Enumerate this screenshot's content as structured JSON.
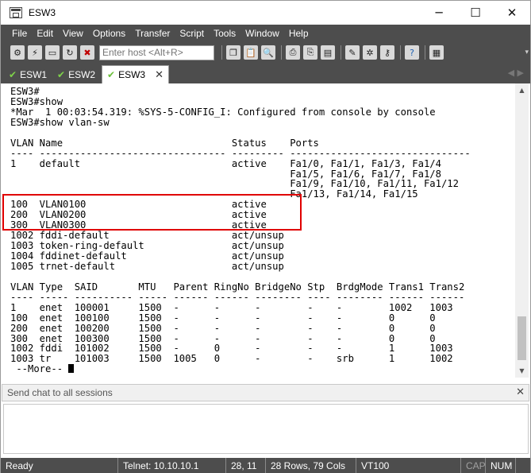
{
  "window": {
    "title": "ESW3",
    "controls": {
      "minimize": "─",
      "maximize": "☐",
      "close": "✕"
    }
  },
  "menu": [
    "File",
    "Edit",
    "View",
    "Options",
    "Transfer",
    "Script",
    "Tools",
    "Window",
    "Help"
  ],
  "toolbar": {
    "host_placeholder": "Enter host <Alt+R>",
    "icons": [
      "connect-icon",
      "quick-connect-icon",
      "connect-tab-icon",
      "reconnect-icon",
      "disconnect-icon",
      "copy-icon",
      "paste-icon",
      "find-icon",
      "print-icon",
      "print-selection-icon",
      "print-screen-icon",
      "session-options-icon",
      "global-options-icon",
      "keymap-icon",
      "help-icon",
      "map-icon"
    ]
  },
  "tabs": [
    {
      "label": "ESW1",
      "active": false
    },
    {
      "label": "ESW2",
      "active": false
    },
    {
      "label": "ESW3",
      "active": true
    }
  ],
  "terminal": {
    "lines": [
      "ESW3#",
      "ESW3#show",
      "*Mar  1 00:03:54.319: %SYS-5-CONFIG_I: Configured from console by console",
      "ESW3#show vlan-sw",
      "",
      "VLAN Name                             Status    Ports",
      "---- -------------------------------- --------- -------------------------------",
      "1    default                          active    Fa1/0, Fa1/1, Fa1/3, Fa1/4",
      "                                                Fa1/5, Fa1/6, Fa1/7, Fa1/8",
      "                                                Fa1/9, Fa1/10, Fa1/11, Fa1/12",
      "                                                Fa1/13, Fa1/14, Fa1/15",
      "100  VLAN0100                         active",
      "200  VLAN0200                         active",
      "300  VLAN0300                         active",
      "1002 fddi-default                     act/unsup",
      "1003 token-ring-default               act/unsup",
      "1004 fddinet-default                  act/unsup",
      "1005 trnet-default                    act/unsup",
      "",
      "VLAN Type  SAID       MTU   Parent RingNo BridgeNo Stp  BrdgMode Trans1 Trans2",
      "---- ----- ---------- ----- ------ ------ -------- ---- -------- ------ ------",
      "1    enet  100001     1500  -      -      -        -    -        1002   1003",
      "100  enet  100100     1500  -      -      -        -    -        0      0",
      "200  enet  100200     1500  -      -      -        -    -        0      0",
      "300  enet  100300     1500  -      -      -        -    -        0      0",
      "1002 fddi  101002     1500  -      0      -        -    -        1      1003",
      "1003 tr    101003     1500  1005   0      -        -    srb      1      1002"
    ],
    "more_prompt": " --More-- "
  },
  "chat": {
    "header": "Send chat to all sessions",
    "close": "✕"
  },
  "status": {
    "ready": "Ready",
    "connection": "Telnet: 10.10.10.1",
    "cursor_pos": "28,  11",
    "size": "28 Rows, 79 Cols",
    "terminal_type": "VT100",
    "caps": "CAP",
    "num": "NUM"
  },
  "colors": {
    "chrome": "#4d4d4d",
    "highlight": "#e00000",
    "tab_check": "#7fd34a"
  }
}
